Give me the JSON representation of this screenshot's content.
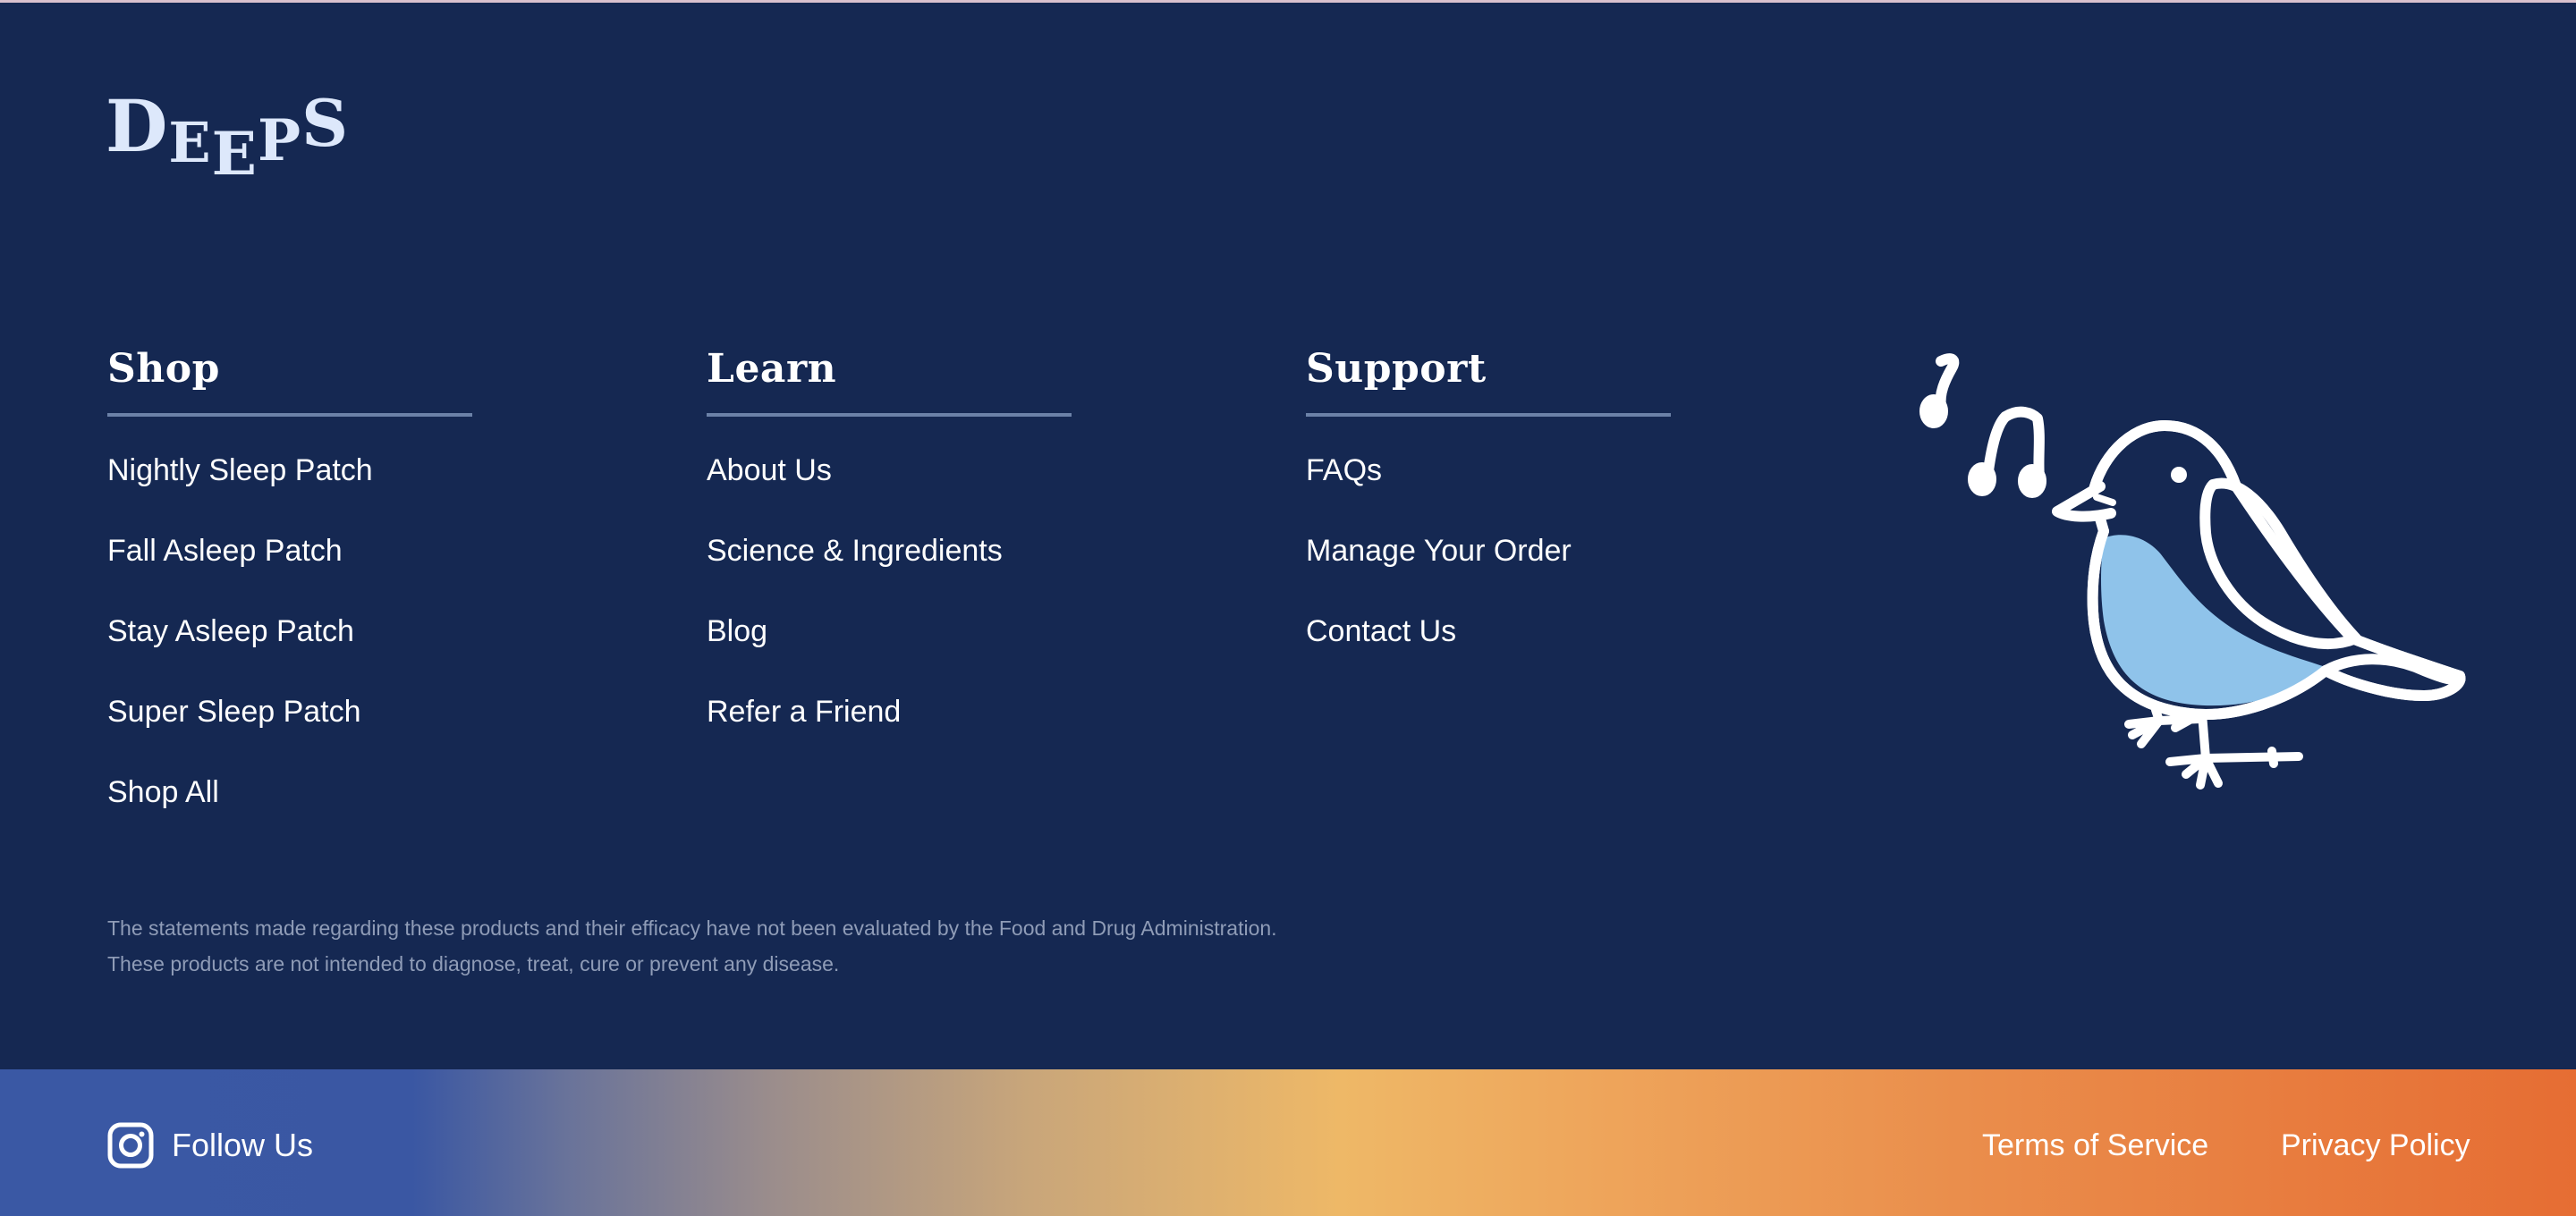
{
  "brand": {
    "logo_letters": [
      "D",
      "E",
      "E",
      "P",
      "S"
    ]
  },
  "footer": {
    "columns": [
      {
        "heading": "Shop",
        "links": [
          "Nightly Sleep Patch",
          "Fall Asleep Patch",
          "Stay Asleep Patch",
          "Super Sleep Patch",
          "Shop All"
        ]
      },
      {
        "heading": "Learn",
        "links": [
          "About Us",
          "Science & Ingredients",
          "Blog",
          "Refer a Friend"
        ]
      },
      {
        "heading": "Support",
        "links": [
          "FAQs",
          "Manage Your Order",
          "Contact Us"
        ]
      }
    ],
    "disclaimer": {
      "line1": "The statements made regarding these products and their efficacy have not been evaluated by the Food and Drug Administration.",
      "line2": "These products are not intended to diagnose, treat, cure or prevent any disease."
    },
    "illustration": {
      "icon": "singing-bird-icon",
      "colors": {
        "outline": "#ffffff",
        "belly": "#8fc3ea",
        "body": "#152852"
      }
    }
  },
  "bottom_bar": {
    "follow_label": "Follow Us",
    "follow_icon": "instagram-icon",
    "terms_label": "Terms of Service",
    "privacy_label": "Privacy Policy"
  },
  "colors": {
    "background": "#152852",
    "text": "#ffffff",
    "muted_text": "#8f9cb7",
    "rule": "#6c82a8",
    "gradient_start": "#3a58a4",
    "gradient_mid": "#eeb867",
    "gradient_end": "#e66d33"
  }
}
